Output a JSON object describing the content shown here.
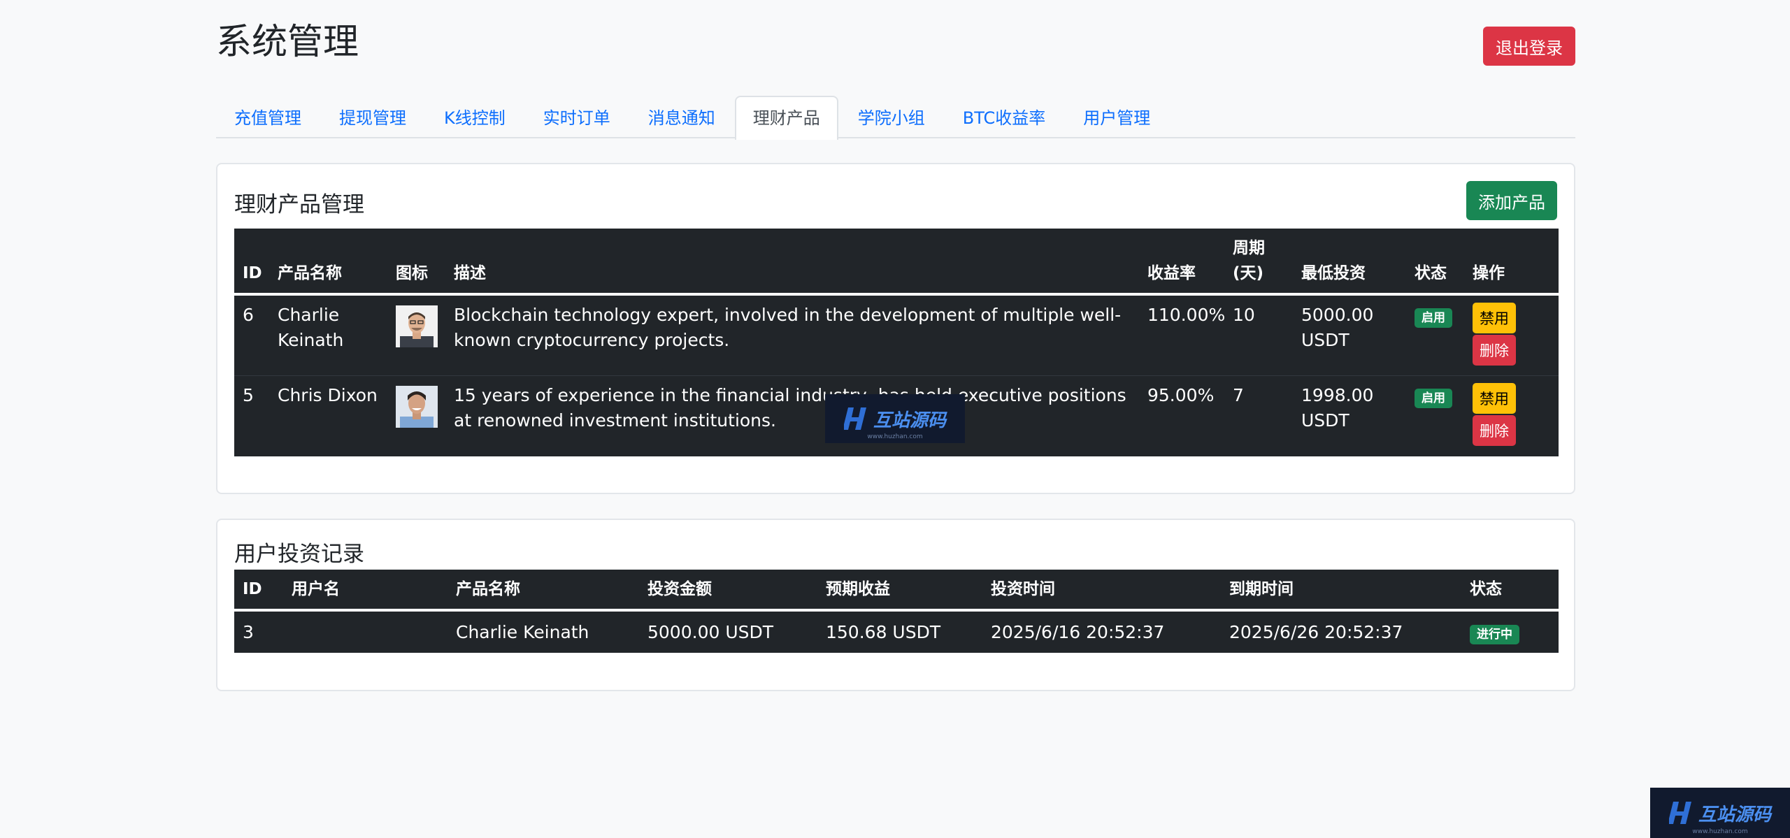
{
  "header": {
    "title": "系统管理",
    "logout_label": "退出登录"
  },
  "tabs": [
    {
      "label": "充值管理",
      "active": false
    },
    {
      "label": "提现管理",
      "active": false
    },
    {
      "label": "K线控制",
      "active": false
    },
    {
      "label": "实时订单",
      "active": false
    },
    {
      "label": "消息通知",
      "active": false
    },
    {
      "label": "理财产品",
      "active": true
    },
    {
      "label": "学院小组",
      "active": false
    },
    {
      "label": "BTC收益率",
      "active": false
    },
    {
      "label": "用户管理",
      "active": false
    }
  ],
  "products": {
    "title": "理财产品管理",
    "add_label": "添加产品",
    "columns": [
      "ID",
      "产品名称",
      "图标",
      "描述",
      "收益率",
      "周期(天)",
      "最低投资",
      "状态",
      "操作"
    ],
    "rows": [
      {
        "id": "6",
        "name": "Charlie Keinath",
        "description": "Blockchain technology expert, involved in the development of multiple well-known cryptocurrency projects.",
        "rate": "110.00%",
        "period": "10",
        "min_invest": "5000.00 USDT",
        "status": "启用",
        "disable_label": "禁用",
        "delete_label": "删除"
      },
      {
        "id": "5",
        "name": "Chris Dixon",
        "description": "15 years of experience in the financial industry, has held executive positions at renowned investment institutions.",
        "rate": "95.00%",
        "period": "7",
        "min_invest": "1998.00 USDT",
        "status": "启用",
        "disable_label": "禁用",
        "delete_label": "删除"
      }
    ]
  },
  "investments": {
    "title": "用户投资记录",
    "columns": [
      "ID",
      "用户名",
      "产品名称",
      "投资金额",
      "预期收益",
      "投资时间",
      "到期时间",
      "状态"
    ],
    "rows": [
      {
        "id": "3",
        "username": "",
        "product": "Charlie Keinath",
        "amount": "5000.00 USDT",
        "expected": "150.68 USDT",
        "invest_time": "2025/6/16 20:52:37",
        "expire_time": "2025/6/26 20:52:37",
        "status": "进行中"
      }
    ]
  },
  "watermark": {
    "text": "互站源码",
    "sub": "www.huzhan.com"
  },
  "colors": {
    "accent": "#0d6efd",
    "danger": "#dc3545",
    "success": "#198754",
    "warning": "#ffc107",
    "table_bg": "#212529"
  }
}
